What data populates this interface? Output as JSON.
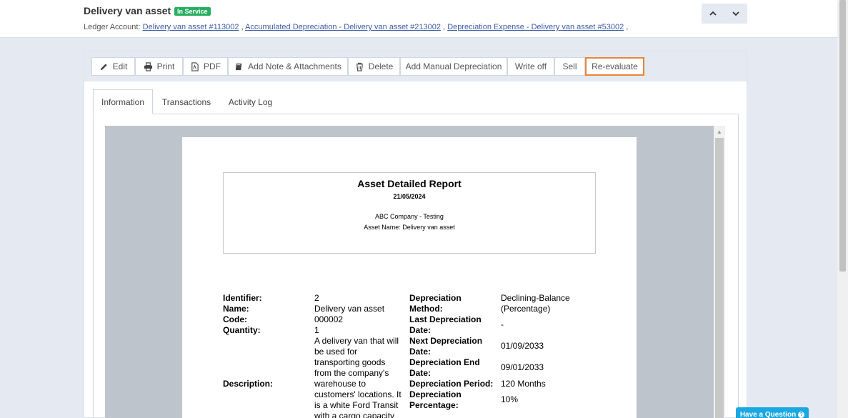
{
  "header": {
    "title": "Delivery van asset",
    "status_badge": "In Service",
    "ledger_label": "Ledger Account:",
    "ledger_links": [
      "Delivery van asset #113002",
      "Accumulated Depreciation - Delivery van asset #213002",
      "Depreciation Expense - Delivery van asset #53002"
    ],
    "nav_icons": [
      "chevron-up-icon",
      "chevron-down-icon"
    ]
  },
  "toolbar": {
    "buttons": [
      {
        "label": "Edit",
        "icon": "pencil-icon"
      },
      {
        "label": "Print",
        "icon": "printer-icon"
      },
      {
        "label": "PDF",
        "icon": "pdf-icon"
      },
      {
        "label": "Add Note & Attachments",
        "icon": "book-icon"
      },
      {
        "label": "Delete",
        "icon": "trash-icon"
      },
      {
        "label": "Add Manual Depreciation"
      },
      {
        "label": "Write off"
      },
      {
        "label": "Sell"
      },
      {
        "label": "Re-evaluate"
      }
    ],
    "active_button": "Re-evaluate",
    "active_color": "#e8853a"
  },
  "tabs": [
    {
      "label": "Information",
      "active": true
    },
    {
      "label": "Transactions",
      "active": false
    },
    {
      "label": "Activity Log",
      "active": false
    }
  ],
  "report": {
    "title": "Asset Detailed Report",
    "date": "21/05/2024",
    "company": "ABC Company - Testing",
    "asset_name_line": "Asset Name: Delivery van asset",
    "left_labels": {
      "identifier": "Identifier:",
      "name": "Name:",
      "code": "Code:",
      "quantity": "Quantity:",
      "description": "Description:"
    },
    "left_values": {
      "identifier": "2",
      "name": "Delivery van asset",
      "code": "000002",
      "quantity": "1",
      "description_lines": [
        "A delivery van that will",
        "be used for",
        "transporting goods",
        "from the company's",
        "warehouse to",
        "customers' locations. It",
        "is a white Ford Transit",
        "with a cargo capacity"
      ]
    },
    "right_labels": {
      "method_1": "Depreciation",
      "method_2": "Method:",
      "last_1": "Last Depreciation",
      "last_2": "Date:",
      "next_1": "Next Depreciation",
      "next_2": "Date:",
      "end_1": "Depreciation End",
      "end_2": "Date:",
      "period": "Depreciation Period:",
      "pct_1": "Depreciation",
      "pct_2": "Percentage:"
    },
    "right_values": {
      "method_1": "Declining-Balance",
      "method_2": "(Percentage)",
      "last": "-",
      "next": "01/09/2033",
      "end": "09/01/2033",
      "period": "120 Months",
      "pct": "10%"
    }
  },
  "help_button": "Have a Question",
  "help_icon": "question-icon"
}
